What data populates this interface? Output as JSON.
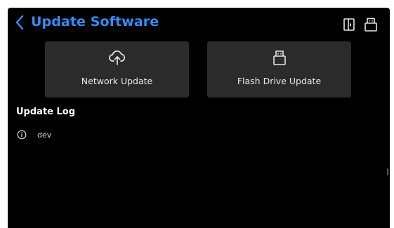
{
  "header": {
    "title": "Update Software",
    "title_color": "#2f8ff5",
    "back_icon": "chevron-left-icon",
    "right_icons": [
      "door-exit-icon",
      "usb-drive-icon"
    ]
  },
  "update_options": [
    {
      "label": "Network Update",
      "icon": "cloud-upload-icon"
    },
    {
      "label": "Flash Drive Update",
      "icon": "usb-drive-icon"
    }
  ],
  "log": {
    "title": "Update Log",
    "entries": [
      {
        "icon": "info-icon",
        "text": "dev"
      }
    ]
  }
}
